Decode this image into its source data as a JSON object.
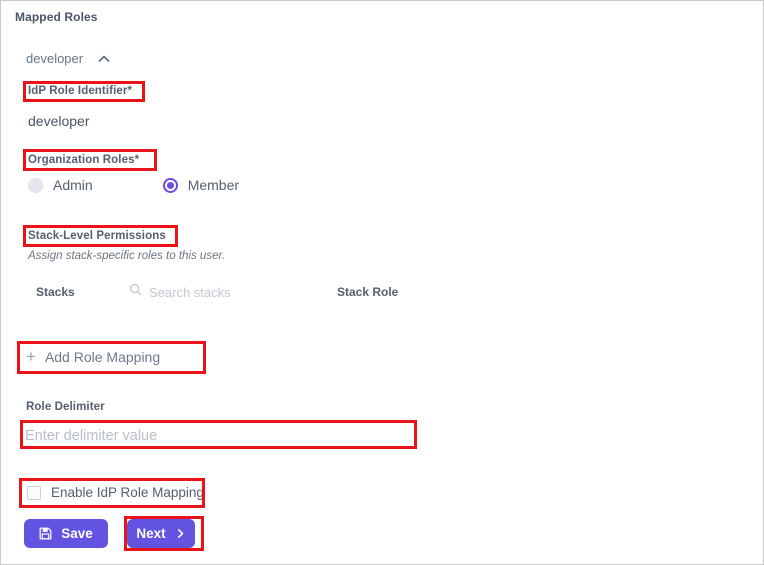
{
  "panel": {
    "title": "Mapped Roles"
  },
  "role_group": {
    "name": "developer",
    "collapse_icon": "chevron-up-icon",
    "expanded": true
  },
  "idp_role_identifier": {
    "label": "IdP Role Identifier*",
    "value": "developer"
  },
  "organization_roles": {
    "label": "Organization Roles*",
    "options": [
      {
        "label": "Admin",
        "selected": false
      },
      {
        "label": "Member",
        "selected": true
      }
    ]
  },
  "stack_level_permissions": {
    "label": "Stack-Level Permissions",
    "helper_text": "Assign stack-specific roles to this user.",
    "table": {
      "columns": [
        "Stacks",
        "Stack Role"
      ],
      "rows": []
    },
    "search": {
      "icon": "search-icon",
      "placeholder": "Search stacks",
      "value": ""
    }
  },
  "add_role_mapping": {
    "icon": "plus-icon",
    "label": "Add Role Mapping"
  },
  "role_delimiter": {
    "label": "Role Delimiter",
    "placeholder": "Enter delimiter value",
    "value": ""
  },
  "enable_idp_role_mapping": {
    "label": "Enable IdP Role Mapping",
    "checked": false
  },
  "footer": {
    "save_label": "Save",
    "save_icon": "save-floppy-icon",
    "next_label": "Next",
    "next_icon": "chevron-right-icon"
  },
  "colors": {
    "accent_purple": "#6254e0",
    "annotation_red": "#e8141a",
    "label_slate": "#55606e",
    "placeholder_gray": "#b9bec7",
    "panel_border": "#c9c9c9"
  },
  "annotations": {
    "highlight_color": "#e8141a",
    "boxes": [
      {
        "target": "idp-role-identifier-label"
      },
      {
        "target": "organization-roles-label"
      },
      {
        "target": "stack-level-permissions-label"
      },
      {
        "target": "add-role-mapping-button"
      },
      {
        "target": "role-delimiter-input"
      },
      {
        "target": "enable-idp-role-mapping-checkbox-row"
      },
      {
        "target": "next-button"
      }
    ]
  }
}
